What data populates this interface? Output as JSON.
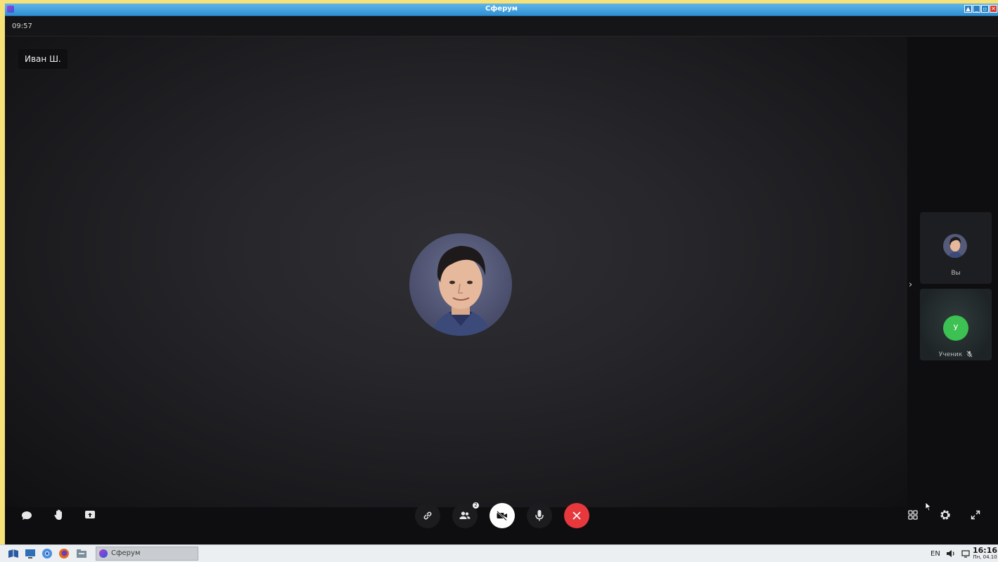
{
  "window": {
    "title": "Сферум"
  },
  "topbar": {
    "elapsed_time": "09:57"
  },
  "stage": {
    "speaker_name": "Иван Ш."
  },
  "participants": [
    {
      "label": "Вы"
    },
    {
      "label": "Ученик",
      "initial": "У",
      "mic_muted": true
    }
  ],
  "controls": {
    "participants_count": "2"
  },
  "taskbar": {
    "task_label": "Сферум",
    "language": "EN",
    "time": "16:16",
    "date": "Пн, 04.10"
  },
  "colors": {
    "end_call": "#e6383d",
    "student_avatar": "#3cc152",
    "titlebar": "#2f8fd2"
  }
}
